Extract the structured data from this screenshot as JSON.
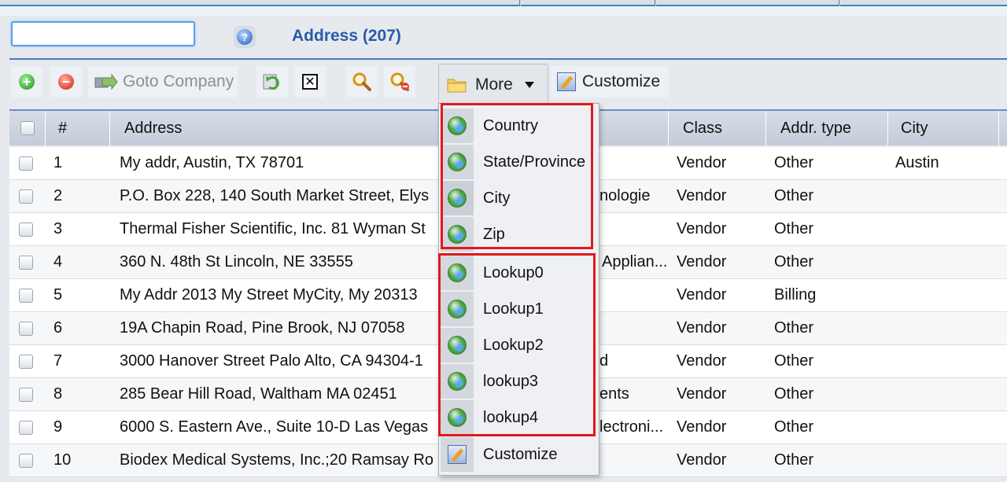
{
  "search": {
    "value": "",
    "placeholder": ""
  },
  "page_title": "Address (207)",
  "toolbar": {
    "goto_company": "Goto Company",
    "more": "More",
    "customize": "Customize"
  },
  "columns": {
    "num": "#",
    "address": "Address",
    "class": "Class",
    "addr_type": "Addr. type",
    "city": "City"
  },
  "rows": [
    {
      "num": "1",
      "address": "My addr, Austin, TX 78701",
      "hidden": "",
      "class": "Vendor",
      "type": "Other",
      "city": "Austin"
    },
    {
      "num": "2",
      "address": "P.O. Box 228, 140 South Market Street, Elys",
      "hidden": "nologie",
      "class": "Vendor",
      "type": "Other",
      "city": ""
    },
    {
      "num": "3",
      "address": "Thermal Fisher Scientific, Inc. 81 Wyman St",
      "hidden": "",
      "class": "Vendor",
      "type": "Other",
      "city": ""
    },
    {
      "num": "4",
      "address": "360 N. 48th St Lincoln, NE 33555",
      "hidden": "Applian...",
      "class": "Vendor",
      "type": "Other",
      "city": ""
    },
    {
      "num": "5",
      "address": "My Addr 2013 My Street MyCity, My 20313",
      "hidden": "",
      "class": "Vendor",
      "type": "Billing",
      "city": ""
    },
    {
      "num": "6",
      "address": "19A Chapin Road, Pine Brook, NJ 07058",
      "hidden": "",
      "class": "Vendor",
      "type": "Other",
      "city": ""
    },
    {
      "num": "7",
      "address": "3000 Hanover Street Palo Alto, CA 94304-1",
      "hidden": "d",
      "class": "Vendor",
      "type": "Other",
      "city": ""
    },
    {
      "num": "8",
      "address": "285 Bear Hill Road, Waltham MA 02451",
      "hidden": "ents",
      "class": "Vendor",
      "type": "Other",
      "city": ""
    },
    {
      "num": "9",
      "address": "6000 S. Eastern Ave., Suite 10-D Las Vegas",
      "hidden": "lectroni...",
      "class": "Vendor",
      "type": "Other",
      "city": ""
    },
    {
      "num": "10",
      "address": "Biodex Medical Systems, Inc.;20 Ramsay Ro",
      "hidden": "",
      "class": "Vendor",
      "type": "Other",
      "city": ""
    }
  ],
  "menu": {
    "group1": [
      "Country",
      "State/Province",
      "City",
      "Zip"
    ],
    "group2": [
      "Lookup0",
      "Lookup1",
      "Lookup2",
      "lookup3",
      "lookup4"
    ],
    "customize": "Customize"
  },
  "colors": {
    "accent": "#2a5aa8",
    "highlight": "#e0191c"
  }
}
